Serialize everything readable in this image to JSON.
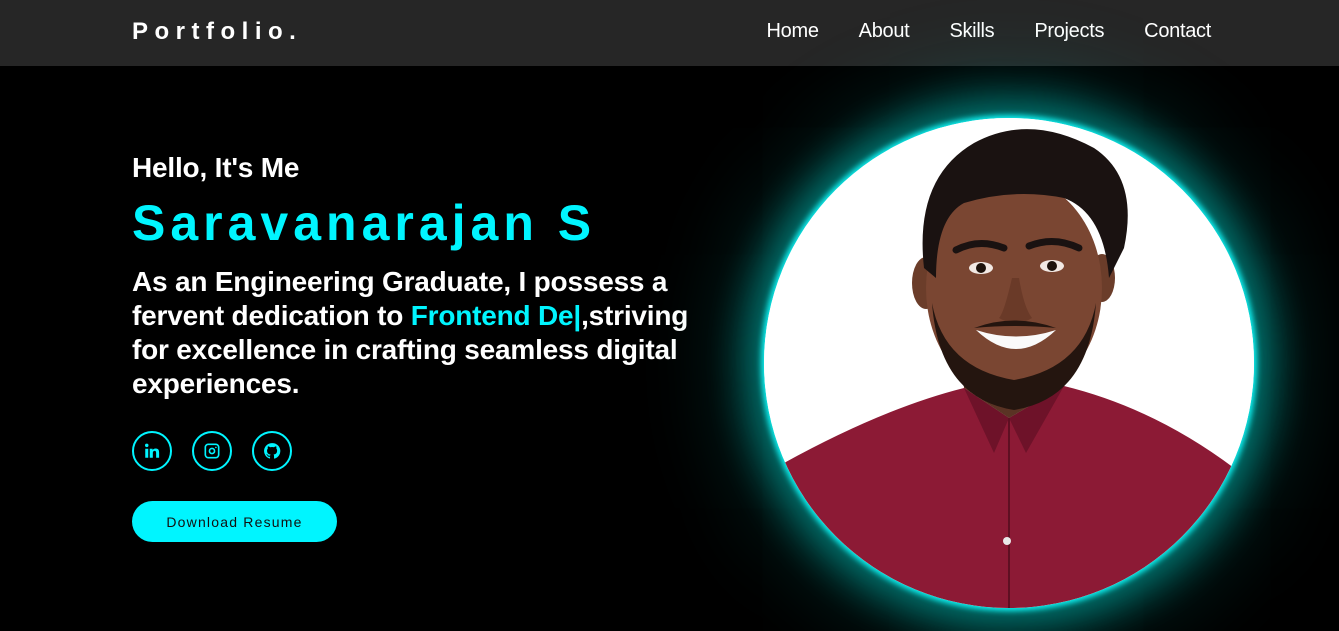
{
  "nav": {
    "logo": "Portfolio.",
    "links": [
      "Home",
      "About",
      "Skills",
      "Projects",
      "Contact"
    ]
  },
  "hero": {
    "greeting": "Hello, It's Me",
    "name": "Saravanarajan S",
    "bio_part1": "As an Engineering Graduate, I possess a fervent dedication to ",
    "bio_accent": "Frontend De|",
    "bio_part2": ",striving for excellence in crafting seamless digital experiences.",
    "socials": [
      {
        "icon": "linkedin-icon"
      },
      {
        "icon": "instagram-icon"
      },
      {
        "icon": "github-icon"
      }
    ],
    "download_label": "Download Resume"
  },
  "colors": {
    "accent": "#00f5ff",
    "navbar_bg": "#262626",
    "page_bg": "#000000",
    "shirt": "#8c1a35"
  }
}
